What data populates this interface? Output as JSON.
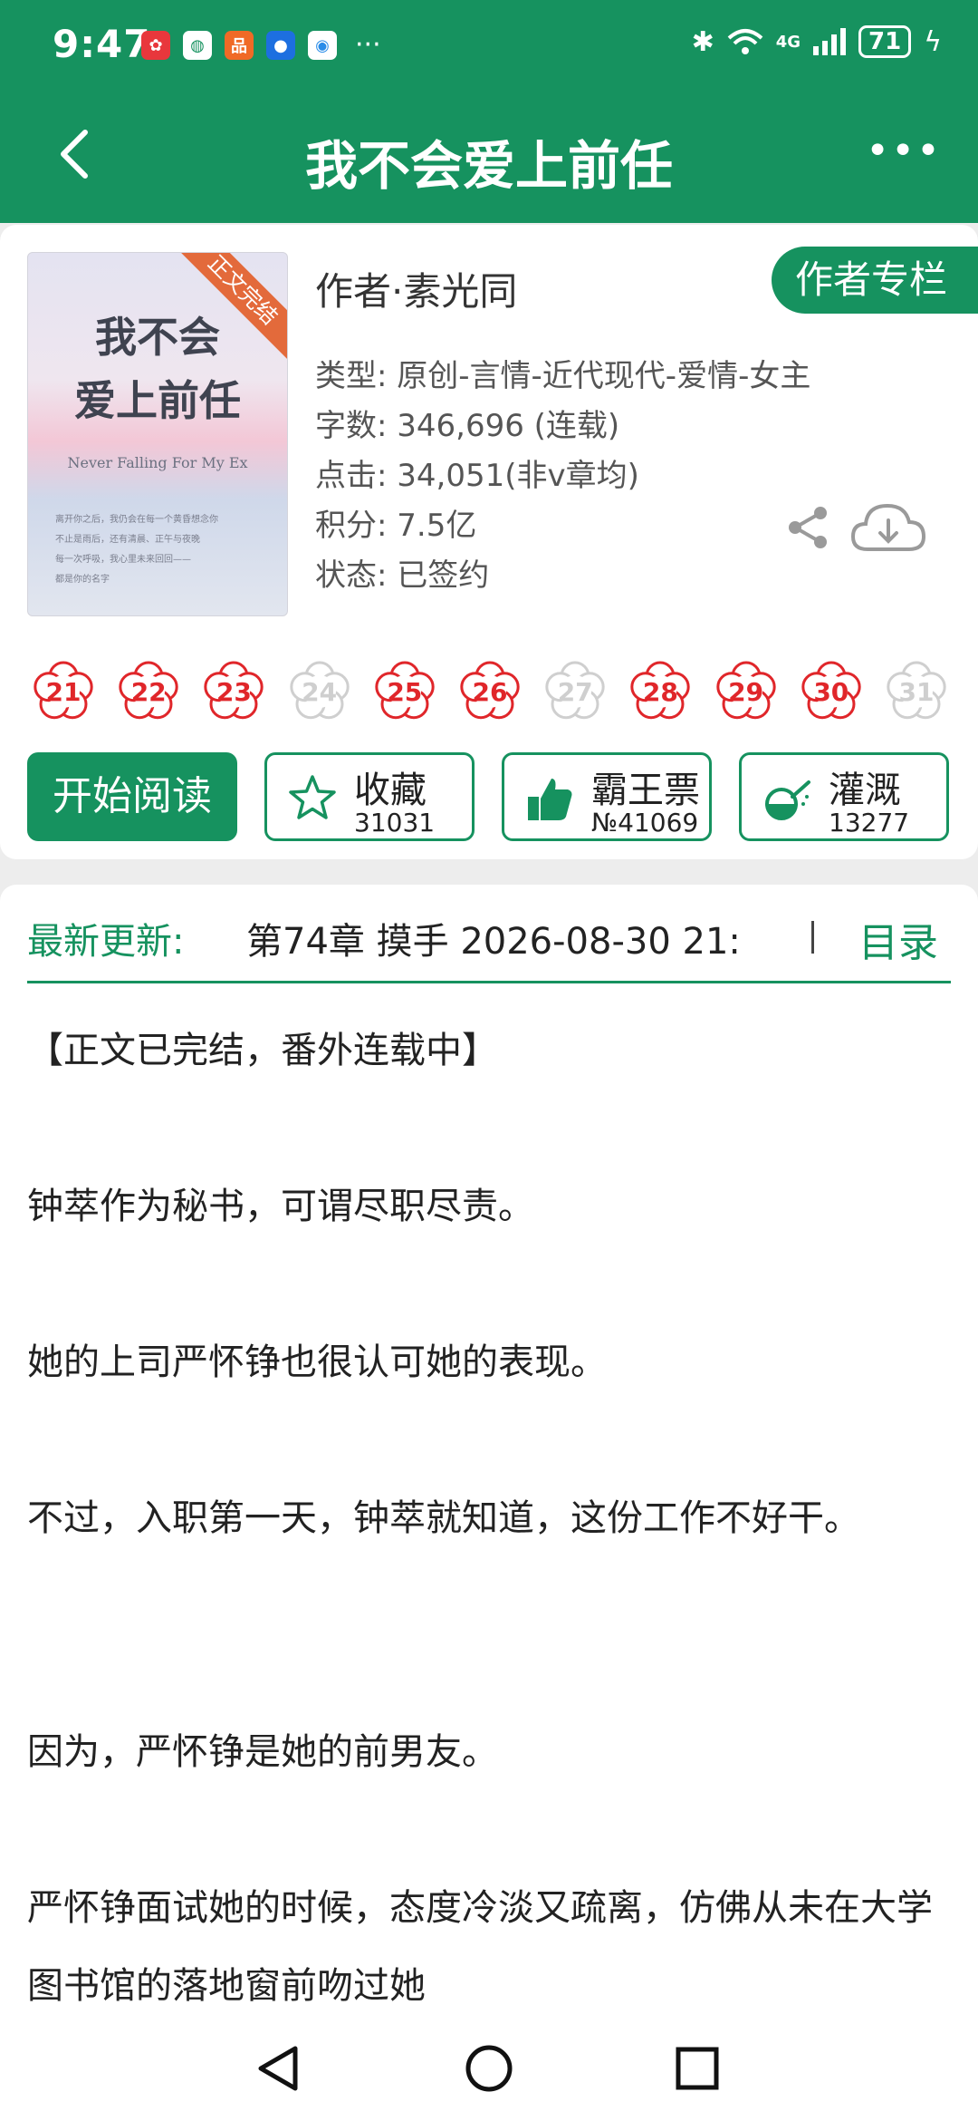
{
  "status_bar": {
    "time": "9:47",
    "apps": [
      {
        "icon": "huawei-app-icon",
        "color": "#e8373c",
        "glyph": "✿"
      },
      {
        "icon": "mobile-app-icon",
        "color": "#ffffff",
        "glyph": "◍"
      },
      {
        "icon": "store-app-icon",
        "color": "#f06a26",
        "glyph": "品"
      },
      {
        "icon": "bulb-app-icon",
        "color": "#1d6fe0",
        "glyph": "●"
      },
      {
        "icon": "browser-app-icon",
        "color": "#2a8ce8",
        "glyph": "◉"
      }
    ],
    "more": "···",
    "network": "4G",
    "battery": "71"
  },
  "header": {
    "title": "我不会爱上前任"
  },
  "book": {
    "cover": {
      "title_line1": "我不会",
      "title_line2": "爱上前任",
      "subtitle": "Never Falling For My Ex",
      "blurb_lines": [
        "离开你之后，我仍会在每一个黄昏想念你",
        "不止是雨后，还有清晨、正午与夜晚",
        "每一次呼吸，我心里未来回回——",
        "都是你的名字"
      ],
      "ribbon": "正文完结"
    },
    "author": "作者·素光同",
    "author_button": "作者专栏",
    "meta": {
      "type": "类型: 原创-言情-近代现代-爱情-女主",
      "words": "字数: 346,696 (连载)",
      "clicks": "点击: 34,051(非v章均)",
      "score": "积分: 7.5亿",
      "status": "状态: 已签约"
    }
  },
  "flowers": [
    {
      "num": "21",
      "active": true
    },
    {
      "num": "22",
      "active": true
    },
    {
      "num": "23",
      "active": true
    },
    {
      "num": "24",
      "active": false
    },
    {
      "num": "25",
      "active": true
    },
    {
      "num": "26",
      "active": true
    },
    {
      "num": "27",
      "active": false
    },
    {
      "num": "28",
      "active": true
    },
    {
      "num": "29",
      "active": true
    },
    {
      "num": "30",
      "active": true
    },
    {
      "num": "31",
      "active": false
    }
  ],
  "actions": {
    "read": "开始阅读",
    "favorite": {
      "label": "收藏",
      "count": "31031"
    },
    "vote": {
      "label": "霸王票",
      "count": "№41069"
    },
    "water": {
      "label": "灌溉",
      "count": "13277"
    }
  },
  "update": {
    "label": "最新更新:",
    "text": "第74章  摸手  2026-08-30 21:",
    "toc": "目录"
  },
  "synopsis": [
    "【正文已完结，番外连载中】",
    "钟萃作为秘书，可谓尽职尽责。",
    "她的上司严怀铮也很认可她的表现。",
    "不过，入职第一天，钟萃就知道，这份工作不好干。",
    "因为，严怀铮是她的前男友。",
    "严怀铮面试她的时候，态度冷淡又疏离，仿佛从未在大学图书馆的落地窗前吻过她"
  ],
  "colors": {
    "brand": "#16925f",
    "flower_active": "#e0262a",
    "flower_inactive": "#cfcfcf"
  }
}
